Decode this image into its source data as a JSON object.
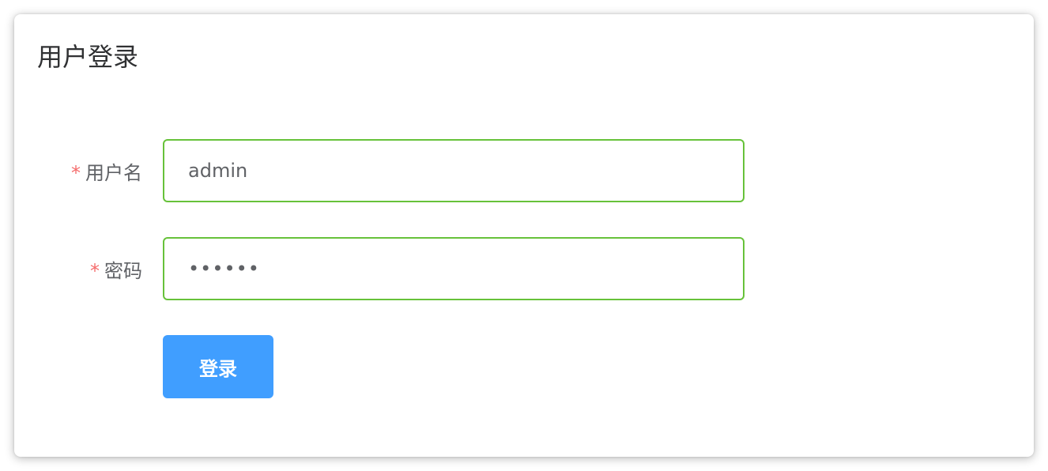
{
  "card": {
    "title": "用户登录"
  },
  "form": {
    "username": {
      "required_mark": "*",
      "label": "用户名",
      "value": "admin"
    },
    "password": {
      "required_mark": "*",
      "label": "密码",
      "value": "••••••"
    },
    "submit_label": "登录"
  },
  "colors": {
    "input_border_valid": "#67c23a",
    "primary_button": "#409eff",
    "required_mark": "#f56c6c",
    "title_text": "#303133",
    "label_text": "#606266"
  }
}
